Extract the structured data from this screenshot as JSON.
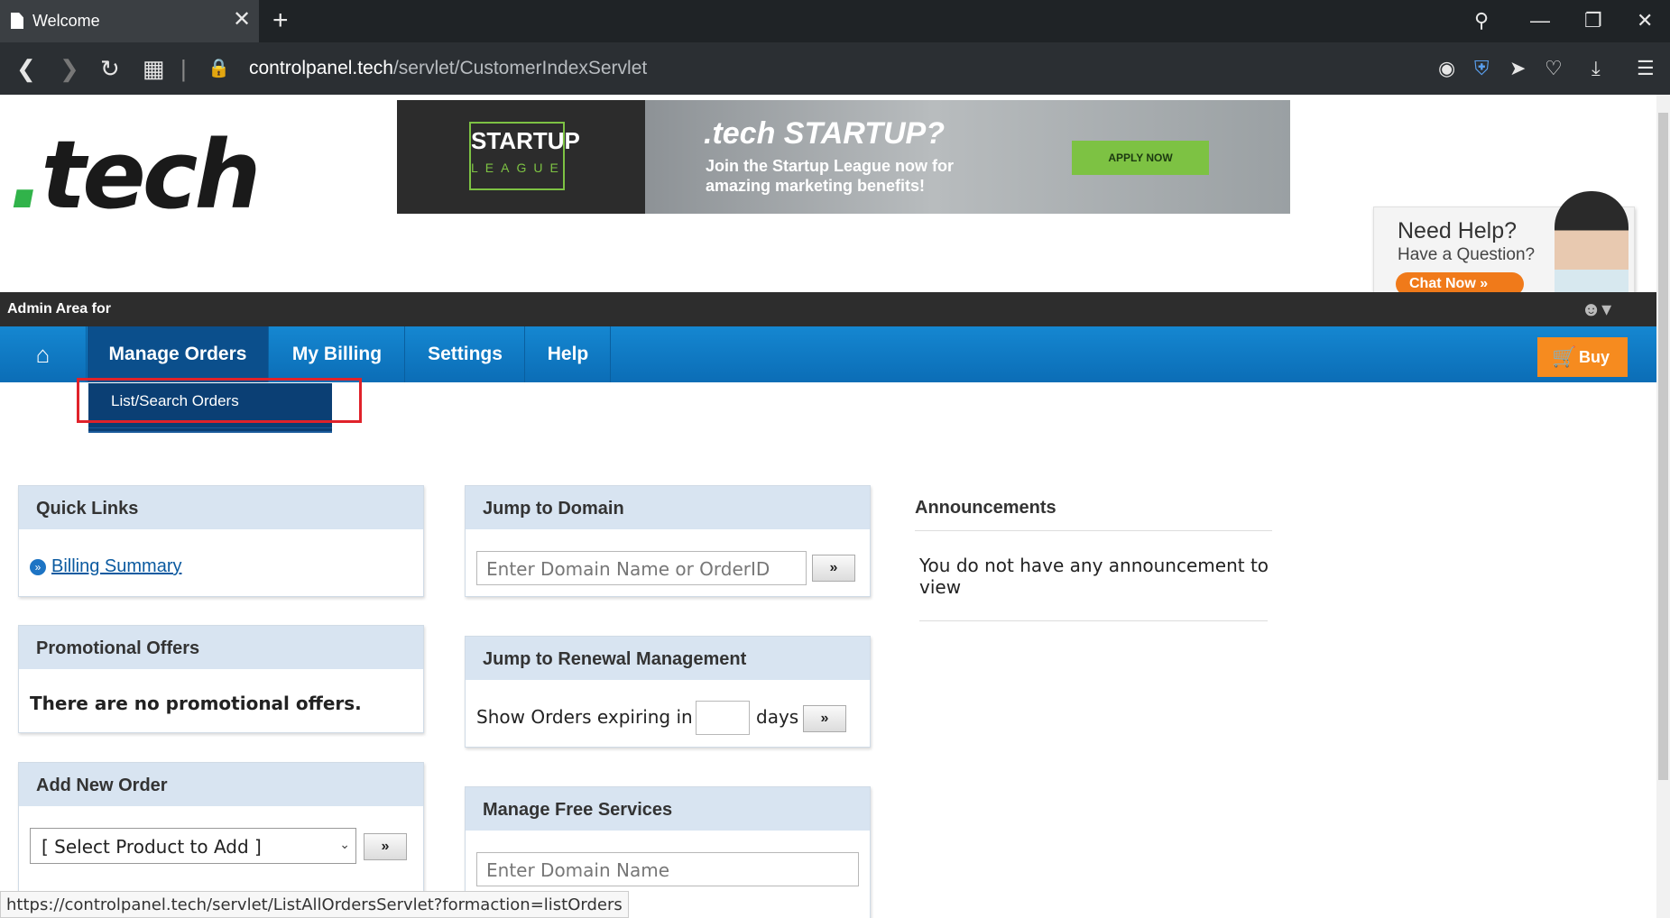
{
  "browser": {
    "tab_title": "Welcome",
    "tab_close": "✕",
    "new_tab": "+",
    "url_host": "controlpanel.tech",
    "url_path": "/servlet/CustomerIndexServlet",
    "window_controls": [
      "search-icon",
      "minimize-icon",
      "restore-icon",
      "close-icon"
    ],
    "extensions": [
      "camera-icon",
      "shield-icon",
      "send-icon",
      "heart-icon",
      "download-icon",
      "settings-icon"
    ]
  },
  "header": {
    "logo_dot": ".",
    "logo_text": "tech",
    "banner": {
      "badge_line1": "STARTUP",
      "badge_line2": "LEAGUE",
      "headline": ".tech STARTUP?",
      "subtext": "Join the Startup League now for amazing marketing benefits!",
      "cta": "APPLY NOW"
    },
    "help": {
      "title": "Need Help?",
      "subtitle": "Have a Question?",
      "chat": "Chat Now"
    }
  },
  "adminbar": {
    "label": "Admin Area for"
  },
  "nav": {
    "items": [
      {
        "label": "⌂",
        "name": "home"
      },
      {
        "label": "Manage Orders",
        "name": "manage-orders"
      },
      {
        "label": "My Billing",
        "name": "my-billing"
      },
      {
        "label": "Settings",
        "name": "settings"
      },
      {
        "label": "Help",
        "name": "help"
      }
    ],
    "buy_label": "Buy",
    "dropdown_item": "List/Search Orders"
  },
  "panels": {
    "quick_links": {
      "title": "Quick Links",
      "link": "Billing Summary"
    },
    "promo": {
      "title": "Promotional Offers",
      "text": "There are no promotional offers."
    },
    "add_order": {
      "title": "Add New Order",
      "select_value": "[ Select Product to Add ]"
    },
    "jump_domain": {
      "title": "Jump to Domain",
      "placeholder": "Enter Domain Name or OrderID"
    },
    "renewal": {
      "title": "Jump to Renewal Management",
      "prefix": "Show Orders expiring in",
      "suffix": "days"
    },
    "free_services": {
      "title": "Manage Free Services",
      "placeholder": "Enter Domain Name"
    },
    "go_label": "»"
  },
  "announcements": {
    "title": "Announcements",
    "text": "You do not have any announcement to view"
  },
  "status_url": "https://controlpanel.tech/servlet/ListAllOrdersServlet?formaction=listOrders"
}
